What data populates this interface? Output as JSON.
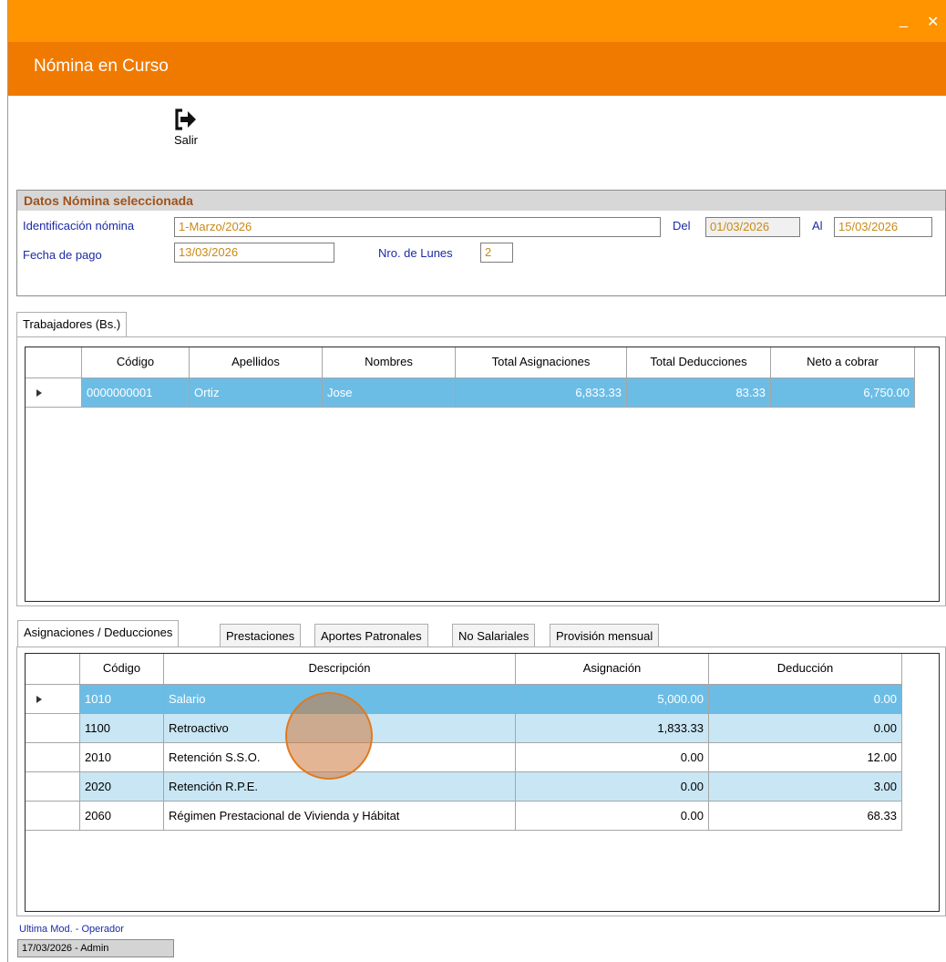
{
  "window": {
    "title": "Nómina en Curso",
    "minimize_glyph": "_",
    "close_glyph": "✕",
    "colors": {
      "topbar": "#ff9400",
      "titlebar": "#f07a00"
    }
  },
  "toolbar": {
    "exit_label": "Salir",
    "exit_icon": "exit-icon"
  },
  "payroll_group": {
    "header": "Datos Nómina seleccionada",
    "id_label": "Identificación nómina",
    "id_value": "1-Marzo/2026",
    "del_label": "Del",
    "del_value": "01/03/2026",
    "al_label": "Al",
    "al_value": "15/03/2026",
    "pay_date_label": "Fecha de pago",
    "pay_date_value": "13/03/2026",
    "mondays_label": "Nro. de Lunes",
    "mondays_value": "2"
  },
  "workers": {
    "tab_label": "Trabajadores (Bs.)",
    "columns": [
      "Código",
      "Apellidos",
      "Nombres",
      "Total Asignaciones",
      "Total Deducciones",
      "Neto a cobrar"
    ],
    "rows": [
      [
        "0000000001",
        "Ortiz",
        "Jose",
        "6,833.33",
        "83.33",
        "6,750.00"
      ]
    ]
  },
  "detail_tabs": [
    "Asignaciones / Deducciones",
    "Prestaciones",
    "Aportes Patronales",
    "No Salariales",
    "Provisión mensual"
  ],
  "concepts": {
    "columns": [
      "Código",
      "Descripción",
      "Asignación",
      "Deducción"
    ],
    "rows": [
      [
        "1010",
        "Salario",
        "5,000.00",
        "0.00"
      ],
      [
        "1100",
        "Retroactivo",
        "1,833.33",
        "0.00"
      ],
      [
        "2010",
        "Retención S.S.O.",
        "0.00",
        "12.00"
      ],
      [
        "2020",
        "Retención R.P.E.",
        "0.00",
        "3.00"
      ],
      [
        "2060",
        "Régimen Prestacional de Vivienda y Hábitat",
        "0.00",
        "68.33"
      ]
    ]
  },
  "footer": {
    "label": "Ultima Mod. - Operador",
    "value": "17/03/2026 - Admin"
  }
}
